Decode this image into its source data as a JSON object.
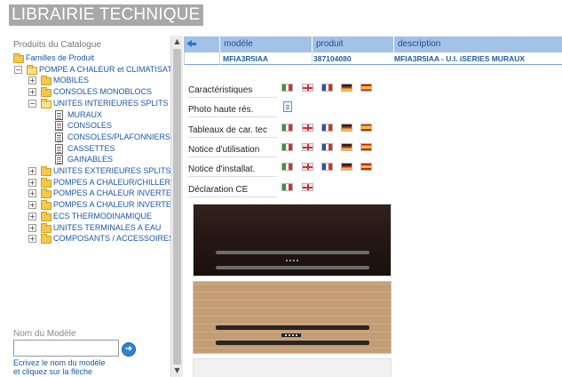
{
  "header": {
    "title": "LIBRAIRIE TECHNIQUE"
  },
  "sidebar": {
    "catalog_heading": "Produits du Catalogue",
    "tree": [
      {
        "label": "Familles de Produit",
        "level": 0,
        "icon": "folder-icon",
        "expander": "none"
      },
      {
        "label": "POMPE A CHALEUR et CLIMATISATION",
        "level": 1,
        "icon": "folder-open-icon",
        "expander": "collapse"
      },
      {
        "label": "MOBILES",
        "level": 2,
        "icon": "folder-icon",
        "expander": "expand"
      },
      {
        "label": "CONSOLES MONOBLOCS",
        "level": 2,
        "icon": "folder-icon",
        "expander": "expand"
      },
      {
        "label": "UNITES INTERIEURES SPLITS",
        "level": 2,
        "icon": "folder-open-icon",
        "expander": "collapse"
      },
      {
        "label": "MURAUX",
        "level": 3,
        "icon": "document-icon",
        "expander": "none",
        "selected": true
      },
      {
        "label": "CONSOLES",
        "level": 3,
        "icon": "document-icon",
        "expander": "none"
      },
      {
        "label": "CONSOLES/PLAFONNIERS",
        "level": 3,
        "icon": "document-icon",
        "expander": "none"
      },
      {
        "label": "CASSETTES",
        "level": 3,
        "icon": "document-icon",
        "expander": "none"
      },
      {
        "label": "GAINABLES",
        "level": 3,
        "icon": "document-icon",
        "expander": "none"
      },
      {
        "label": "UNITES EXTERIEURES SPLITS",
        "level": 2,
        "icon": "folder-icon",
        "expander": "expand"
      },
      {
        "label": "POMPES A CHALEUR/CHILLERS",
        "level": 2,
        "icon": "folder-icon",
        "expander": "expand"
      },
      {
        "label": "POMPES A CHALEUR INVERTER",
        "level": 2,
        "icon": "folder-icon",
        "expander": "expand"
      },
      {
        "label": "POMPES A CHALEUR INVERTER",
        "level": 2,
        "icon": "folder-icon",
        "expander": "expand"
      },
      {
        "label": "ECS THERMODINAMIQUE",
        "level": 2,
        "icon": "folder-icon",
        "expander": "expand"
      },
      {
        "label": "UNITES TERMINALES A EAU",
        "level": 2,
        "icon": "folder-icon",
        "expander": "expand"
      },
      {
        "label": "COMPOSANTS / ACCESSOIRES",
        "level": 2,
        "icon": "folder-icon",
        "expander": "expand"
      }
    ],
    "model_label": "Nom du Modèle",
    "model_value": "",
    "go_icon": "arrow-right-circle-icon",
    "help_line1": "Ecrivez le nom du modèle",
    "help_line2": "et cliquez sur la flèche"
  },
  "results": {
    "back_icon": "arrow-left-icon",
    "columns": {
      "model": "modèle",
      "product": "produit",
      "description": "description"
    },
    "row": {
      "model": "MFIA3R5IAA",
      "product": "387104080",
      "description": "MFIA3R5IAA - U.I. iSERIES MURAUX"
    }
  },
  "documents": [
    {
      "label": "Caractéristiques",
      "flags": [
        "it",
        "gb",
        "fr",
        "de",
        "es"
      ]
    },
    {
      "label": "Photo haute rés.",
      "flags": [
        "file"
      ]
    },
    {
      "label": "Tableaux de car. tec",
      "flags": [
        "it",
        "gb",
        "fr",
        "de",
        "es"
      ]
    },
    {
      "label": "Notice d'utilisation",
      "flags": [
        "it",
        "gb",
        "fr",
        "de",
        "es"
      ]
    },
    {
      "label": "Notice d'installat.",
      "flags": [
        "it",
        "gb",
        "fr",
        "de",
        "es"
      ]
    },
    {
      "label": "Déclaration CE",
      "flags": [
        "it",
        "gb"
      ]
    }
  ],
  "colors": {
    "link_blue": "#1a58a8",
    "header_gray": "#a8a8a8",
    "table_header": "#a3c2e6"
  }
}
